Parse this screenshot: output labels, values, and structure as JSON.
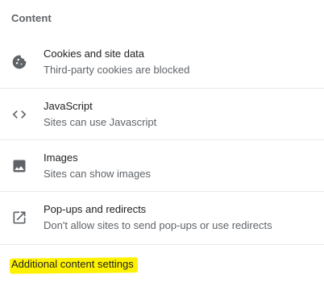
{
  "section": {
    "title": "Content"
  },
  "items": [
    {
      "label": "Cookies and site data",
      "sublabel": "Third-party cookies are blocked",
      "icon": "cookie-icon"
    },
    {
      "label": "JavaScript",
      "sublabel": "Sites can use Javascript",
      "icon": "code-icon"
    },
    {
      "label": "Images",
      "sublabel": "Sites can show images",
      "icon": "image-icon"
    },
    {
      "label": "Pop-ups and redirects",
      "sublabel": "Don't allow sites to send pop-ups or use redirects",
      "icon": "open-in-new-icon"
    }
  ],
  "additional": {
    "label": "Additional content settings",
    "highlight_color": "#fff200"
  },
  "colors": {
    "primary_text": "#202124",
    "secondary_text": "#5f6368",
    "divider": "#e8eaed"
  }
}
